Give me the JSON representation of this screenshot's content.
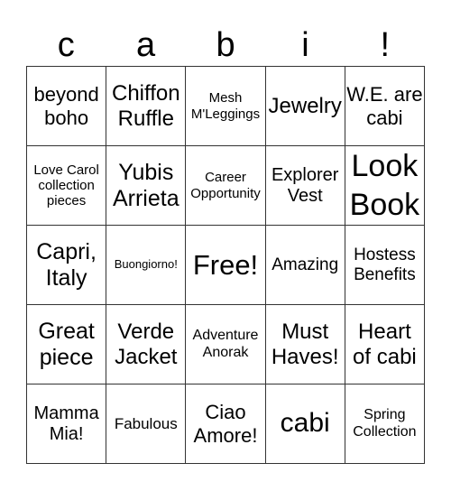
{
  "header": {
    "letters": [
      "c",
      "a",
      "b",
      "i",
      "!"
    ]
  },
  "board": {
    "rows": [
      [
        "beyond boho",
        "Chiffon Ruffle",
        "Mesh M'Leggings",
        "Jewelry",
        "W.E. are cabi"
      ],
      [
        "Love Carol collection pieces",
        "Yubis Arrieta",
        "Career Opportunity",
        "Explorer Vest",
        "Look Book"
      ],
      [
        "Capri, Italy",
        "Buongiorno!",
        "Free!",
        "Amazing",
        "Hostess Benefits"
      ],
      [
        "Great piece",
        "Verde Jacket",
        "Adventure Anorak",
        "Must Haves!",
        "Heart of cabi"
      ],
      [
        "Mamma Mia!",
        "Fabulous",
        "Ciao Amore!",
        "cabi",
        "Spring Collection"
      ]
    ]
  }
}
